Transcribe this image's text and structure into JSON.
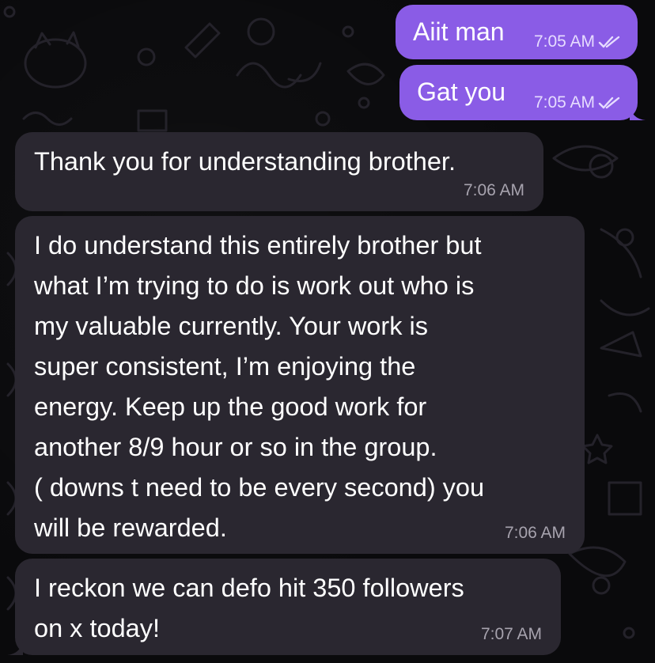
{
  "colors": {
    "background": "#0a0a0c",
    "incoming_bubble": "#2a2730",
    "outgoing_bubble": "#8a5ce6",
    "incoming_time": "#a7a3ae",
    "outgoing_time": "#e6dcff"
  },
  "messages": [
    {
      "direction": "outgoing",
      "text": "Aiit man",
      "time": "7:05 AM",
      "status_icon": "double-check-icon"
    },
    {
      "direction": "outgoing",
      "text": "Gat you",
      "time": "7:05 AM",
      "status_icon": "double-check-icon"
    },
    {
      "direction": "incoming",
      "text": "Thank you for understanding brother.",
      "time": "7:06 AM"
    },
    {
      "direction": "incoming",
      "text": "I do understand this entirely brother but\nwhat I’m trying to do is work out who is\nmy valuable currently. Your work is\nsuper consistent, I’m enjoying the\nenergy. Keep up the good work for\nanother 8/9 hour or so in the group.\n( downs t need to be every second) you\nwill be rewarded.",
      "time": "7:06 AM"
    },
    {
      "direction": "incoming",
      "text": "I reckon we can defo hit 350 followers\non x today!",
      "time": "7:07 AM"
    }
  ]
}
